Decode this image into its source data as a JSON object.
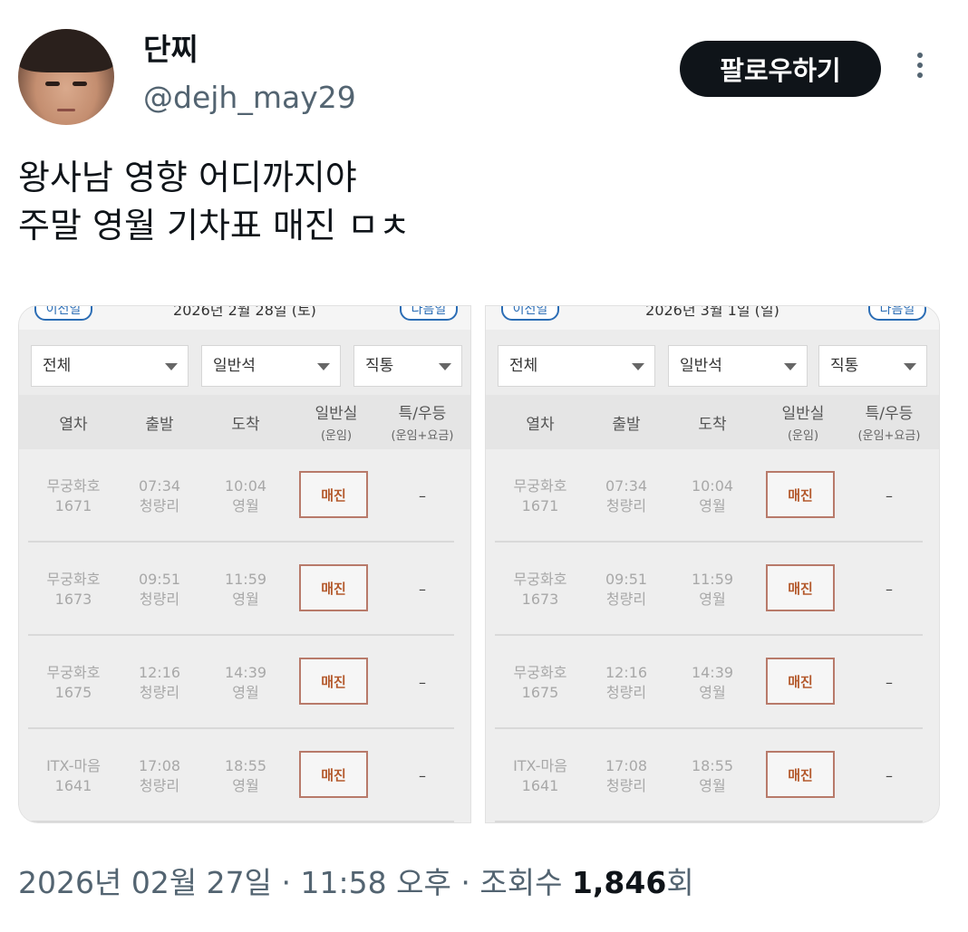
{
  "author": {
    "display_name": "단찌",
    "handle": "@dejh_may29",
    "follow_label": "팔로우하기"
  },
  "tweet": {
    "line1": "왕사남 영향 어디까지야",
    "line2": "주말 영월 기차표 매진 ㅁㅊ"
  },
  "meta": {
    "date": "2026년 02월 27일",
    "sep1": "·",
    "time": "11:58 오후",
    "sep2": "·",
    "views_label": "조회수",
    "views_count": "1,846",
    "views_suffix": "회"
  },
  "panels": [
    {
      "prev_label": "이전일",
      "date": "2026년 2월 28일 (토)",
      "next_label": "다음일",
      "filters": [
        "전체",
        "일반석",
        "직통"
      ],
      "headers": [
        "열차",
        "출발",
        "도착",
        "일반실",
        "(운임)",
        "특/우등",
        "(운임+요금)"
      ],
      "rows": [
        {
          "train": "무궁화호",
          "no": "1671",
          "dep_time": "07:34",
          "dep_station": "청량리",
          "arr_time": "10:04",
          "arr_station": "영월",
          "status": "매진",
          "premium": "–"
        },
        {
          "train": "무궁화호",
          "no": "1673",
          "dep_time": "09:51",
          "dep_station": "청량리",
          "arr_time": "11:59",
          "arr_station": "영월",
          "status": "매진",
          "premium": "–"
        },
        {
          "train": "무궁화호",
          "no": "1675",
          "dep_time": "12:16",
          "dep_station": "청량리",
          "arr_time": "14:39",
          "arr_station": "영월",
          "status": "매진",
          "premium": "–"
        },
        {
          "train": "ITX-마음",
          "no": "1641",
          "dep_time": "17:08",
          "dep_station": "청량리",
          "arr_time": "18:55",
          "arr_station": "영월",
          "status": "매진",
          "premium": "–"
        }
      ]
    },
    {
      "prev_label": "이전일",
      "date": "2026년 3월 1일 (일)",
      "next_label": "다음일",
      "filters": [
        "전체",
        "일반석",
        "직통"
      ],
      "headers": [
        "열차",
        "출발",
        "도착",
        "일반실",
        "(운임)",
        "특/우등",
        "(운임+요금)"
      ],
      "rows": [
        {
          "train": "무궁화호",
          "no": "1671",
          "dep_time": "07:34",
          "dep_station": "청량리",
          "arr_time": "10:04",
          "arr_station": "영월",
          "status": "매진",
          "premium": "–"
        },
        {
          "train": "무궁화호",
          "no": "1673",
          "dep_time": "09:51",
          "dep_station": "청량리",
          "arr_time": "11:59",
          "arr_station": "영월",
          "status": "매진",
          "premium": "–"
        },
        {
          "train": "무궁화호",
          "no": "1675",
          "dep_time": "12:16",
          "dep_station": "청량리",
          "arr_time": "14:39",
          "arr_station": "영월",
          "status": "매진",
          "premium": "–"
        },
        {
          "train": "ITX-마음",
          "no": "1641",
          "dep_time": "17:08",
          "dep_station": "청량리",
          "arr_time": "18:55",
          "arr_station": "영월",
          "status": "매진",
          "premium": "–"
        }
      ]
    }
  ]
}
